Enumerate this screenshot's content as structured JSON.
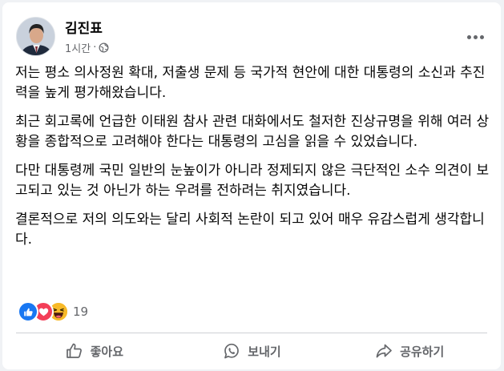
{
  "post": {
    "author": "김진표",
    "time": "1시간",
    "audience_icon": "globe-icon",
    "paragraphs": [
      "저는 평소 의사정원 확대, 저출생 문제 등 국가적 현안에 대한 대통령의 소신과 추진력을 높게 평가해왔습니다.",
      "최근 회고록에 언급한 이태원 참사 관련 대화에서도 철저한 진상규명을 위해 여러 상황을 종합적으로 고려해야 한다는 대통령의 고심을 읽을 수 있었습니다.",
      "다만 대통령께 국민 일반의 눈높이가 아니라 정제되지 않은 극단적인 소수 의견이 보고되고 있는 것 아닌가 하는 우려를 전하려는 취지였습니다.",
      "결론적으로 저의 의도와는 달리 사회적 논란이 되고 있어 매우 유감스럽게 생각합니다."
    ]
  },
  "reactions": {
    "icons": [
      "like-icon",
      "love-icon",
      "haha-icon"
    ],
    "count": "19"
  },
  "actions": {
    "like": "좋아요",
    "comment": "보내기",
    "share": "공유하기"
  },
  "colors": {
    "like_blue": "#1877f2",
    "love_red": "#f33e58",
    "haha_yellow": "#f7b928",
    "secondary_text": "#65676b"
  }
}
